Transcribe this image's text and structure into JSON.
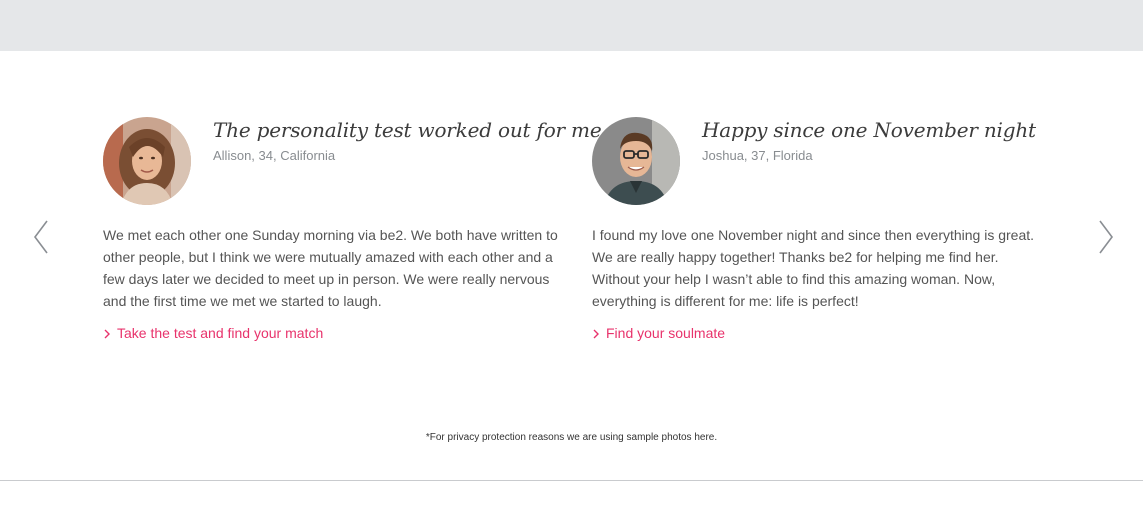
{
  "testimonials": [
    {
      "headline": "The personality test worked out for me",
      "byline": "Allison, 34, California",
      "body": "We met each other one Sunday morning via be2. We both have written to other people, but I think we were mutually amazed with each other and a few days later we decided to meet up in person. We were really nervous and the first time we met we started to laugh.",
      "cta": "Take the test and find your match",
      "avatar_icon": "woman-photo"
    },
    {
      "headline": "Happy since one November night",
      "byline": "Joshua, 37, Florida",
      "body": "I found my love one November night and since then everything is great. We are really happy together! Thanks be2 for helping me find her. Without your help I wasn’t able to find this amazing woman. Now, everything is different for me: life is perfect!",
      "cta": "Find your soulmate",
      "avatar_icon": "man-photo"
    }
  ],
  "navigation": {
    "prev_icon": "chevron-left-icon",
    "next_icon": "chevron-right-icon"
  },
  "disclaimer": "*For privacy protection reasons we are using sample photos here.",
  "colors": {
    "accent": "#e8336c",
    "top_band": "#e5e7e9",
    "body_text": "#555555",
    "byline_text": "#888c90",
    "divider": "#c9cbce"
  }
}
